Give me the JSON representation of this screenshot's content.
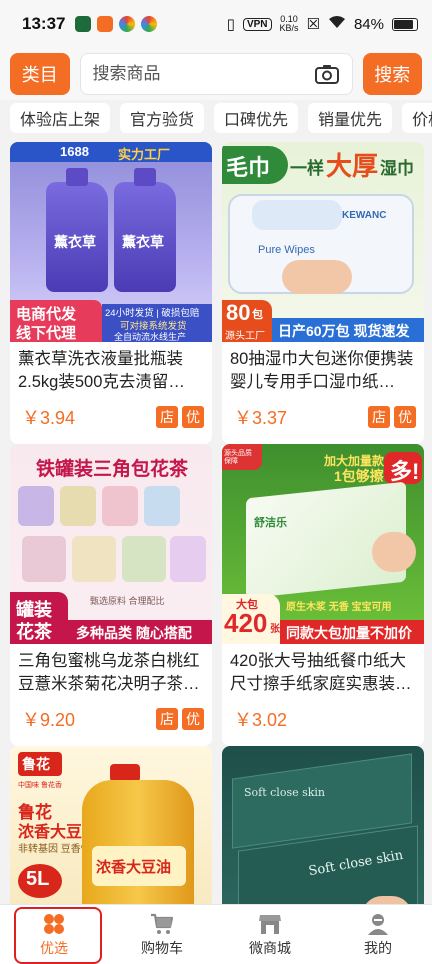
{
  "status_bar": {
    "time": "13:37",
    "vpn": "VPN",
    "speed_value": "0.10",
    "speed_unit": "KB/s",
    "battery": "84%"
  },
  "header": {
    "category_label": "类目",
    "search_placeholder": "搜索商品",
    "search_label": "搜索"
  },
  "filters": [
    "体验店上架",
    "官方验货",
    "口碑优先",
    "销量优先",
    "价格"
  ],
  "products": [
    {
      "title": "薰衣草洗衣液量批瓶装2.5kg装500克去渍留…",
      "price": "￥3.94",
      "tags": [
        "店",
        "优"
      ],
      "image_text": {
        "badge": "1688",
        "badge2": "实力工厂",
        "product": "薰衣草",
        "corner_line1": "电商代发",
        "corner_line2": "线下代理",
        "side_line1": "24小时发货 | 破损包赔",
        "side_line2": "可对接系统发货",
        "side_line3": "全自动流水线生产"
      }
    },
    {
      "title": "80抽湿巾大包迷你便携装婴儿专用手口湿巾纸…",
      "price": "￥3.37",
      "tags": [
        "店",
        "优"
      ],
      "image_text": {
        "headline_a": "毛巾",
        "headline_b": "一样",
        "headline_c": "大厚",
        "headline_d": "湿巾",
        "brand": "KEWANC",
        "pack": "Pure Wipes",
        "count": "80",
        "count_unit": "包",
        "count_sub": "源头工厂",
        "footer": "日产60万包 现货速发"
      }
    },
    {
      "title": "三角包蜜桃乌龙茶白桃红豆薏米茶菊花决明子茶…",
      "price": "￥9.20",
      "tags": [
        "店",
        "优"
      ],
      "image_text": {
        "headline": "铁罐装三角包花茶",
        "corner_line1": "罐装",
        "corner_line2": "花茶",
        "small": "甄选原料 合理配比",
        "footer": "多种品类 随心搭配"
      }
    },
    {
      "title": "420张大号抽纸餐巾纸大尺寸擦手纸家庭实惠装…",
      "price": "￥3.02",
      "tags": [],
      "image_text": {
        "top_left": "源头品质保障",
        "promo": "加大加量款",
        "promo2": "1包够擦",
        "promo3": "多!",
        "brand": "舒洁乐",
        "feature": "原生木浆 无香 宝宝可用",
        "count_top": "大包",
        "count": "420",
        "count_unit": "张",
        "footer": "同款大包加量不加价"
      }
    },
    {
      "title": "",
      "price": "",
      "tags": [],
      "image_text": {
        "brand": "鲁花",
        "sub": "中国味 鲁花香",
        "product_line1": "鲁花",
        "product_line2": "浓香大豆油",
        "tagline": "非转基因 豆香怡人",
        "volume": "5L",
        "label": "浓香大豆油"
      }
    },
    {
      "title": "",
      "price": "",
      "tags": [],
      "image_text": {
        "text1": "Soft close skin",
        "text2": "Soft close skin"
      }
    }
  ],
  "bottom_nav": [
    {
      "label": "优选",
      "icon": "clover-icon",
      "active": true
    },
    {
      "label": "购物车",
      "icon": "cart-icon",
      "active": false
    },
    {
      "label": "微商城",
      "icon": "store-icon",
      "active": false
    },
    {
      "label": "我的",
      "icon": "profile-icon",
      "active": false
    }
  ],
  "colors": {
    "accent": "#f46d25",
    "active_outline": "#e02020"
  }
}
